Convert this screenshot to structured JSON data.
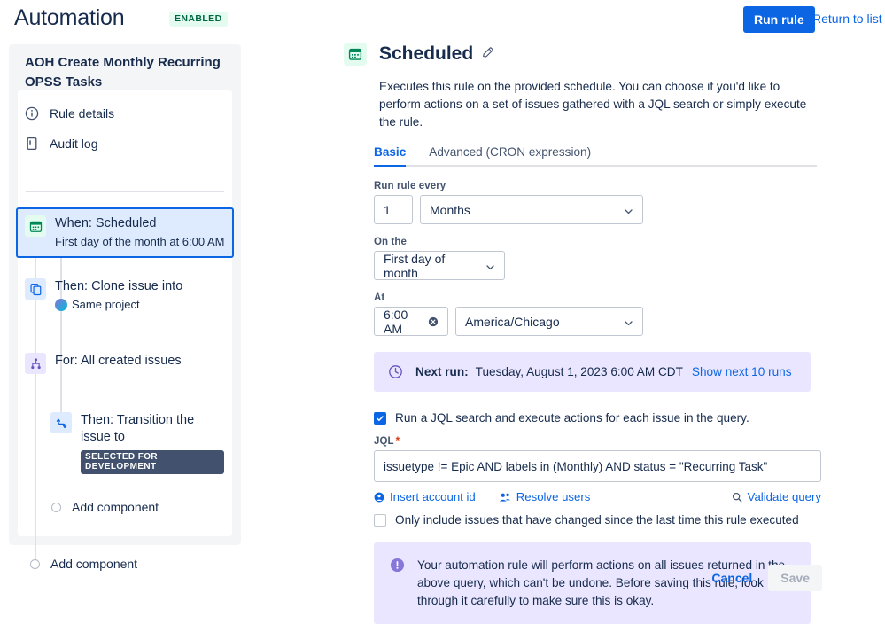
{
  "header": {
    "title": "Automation",
    "status_badge": "ENABLED",
    "run_rule_label": "Run rule",
    "return_label": "Return to list",
    "accent_color": "#0C66E4",
    "badge_bg": "#E3FCEF",
    "badge_fg": "#006644"
  },
  "sidebar": {
    "rule_name": "AOH Create Monthly Recurring OPSS Tasks",
    "nav": [
      {
        "label": "Rule details",
        "icon": "info-icon"
      },
      {
        "label": "Audit log",
        "icon": "audit-log-icon"
      }
    ],
    "components": [
      {
        "title": "When: Scheduled",
        "subtitle": "First day of the month at 6:00 AM",
        "icon": "calendar-icon",
        "selected": true
      },
      {
        "title": "Then: Clone issue into",
        "subtitle": "Same project",
        "icon": "copy-icon",
        "selected": false
      },
      {
        "title": "For: All created issues",
        "subtitle": "",
        "icon": "branch-icon",
        "selected": false
      },
      {
        "title": "Then: Transition the issue to",
        "subtitle": "",
        "lozenge": "SELECTED FOR DEVELOPMENT",
        "icon": "transition-icon",
        "selected": false
      }
    ],
    "add_component_inner": "Add component",
    "add_component_outer": "Add component"
  },
  "main": {
    "icon": "calendar-icon",
    "title": "Scheduled",
    "edit_icon": "pencil-icon",
    "description": "Executes this rule on the provided schedule. You can choose if you'd like to perform actions on a set of issues gathered with a JQL search or simply execute the rule.",
    "tabs": [
      {
        "label": "Basic",
        "active": true
      },
      {
        "label": "Advanced (CRON expression)",
        "active": false
      }
    ],
    "run_rule_every": {
      "label": "Run rule every",
      "interval_value": "1",
      "unit_value": "Months"
    },
    "on_the": {
      "label": "On the",
      "value": "First day of month"
    },
    "at": {
      "label": "At",
      "time_value": "6:00 AM",
      "timezone_value": "America/Chicago",
      "clear_icon": "clear-icon"
    },
    "next_run": {
      "icon": "clock-icon",
      "label": "Next run:",
      "value": "Tuesday, August 1, 2023 6:00 AM CDT",
      "link": "Show next 10 runs",
      "bg": "#EAE6FF"
    },
    "jql_checkbox": {
      "label": "Run a JQL search and execute actions for each issue in the query.",
      "checked": true
    },
    "jql": {
      "label": "JQL",
      "required_mark": "*",
      "value": "issuetype != Epic AND labels in (Monthly) AND status = \"Recurring Task\"",
      "insert_account_id": "Insert account id",
      "resolve_users": "Resolve users",
      "validate_query": "Validate query"
    },
    "only_changed_checkbox": {
      "label": "Only include issues that have changed since the last time this rule executed",
      "checked": false
    },
    "warning": {
      "icon": "warning-icon",
      "text": "Your automation rule will perform actions on all issues returned in the above query, which can't be undone. Before saving this rule, look through it carefully to make sure this is okay.",
      "bg": "#EAE6FF"
    },
    "cancel_label": "Cancel",
    "save_label": "Save"
  }
}
